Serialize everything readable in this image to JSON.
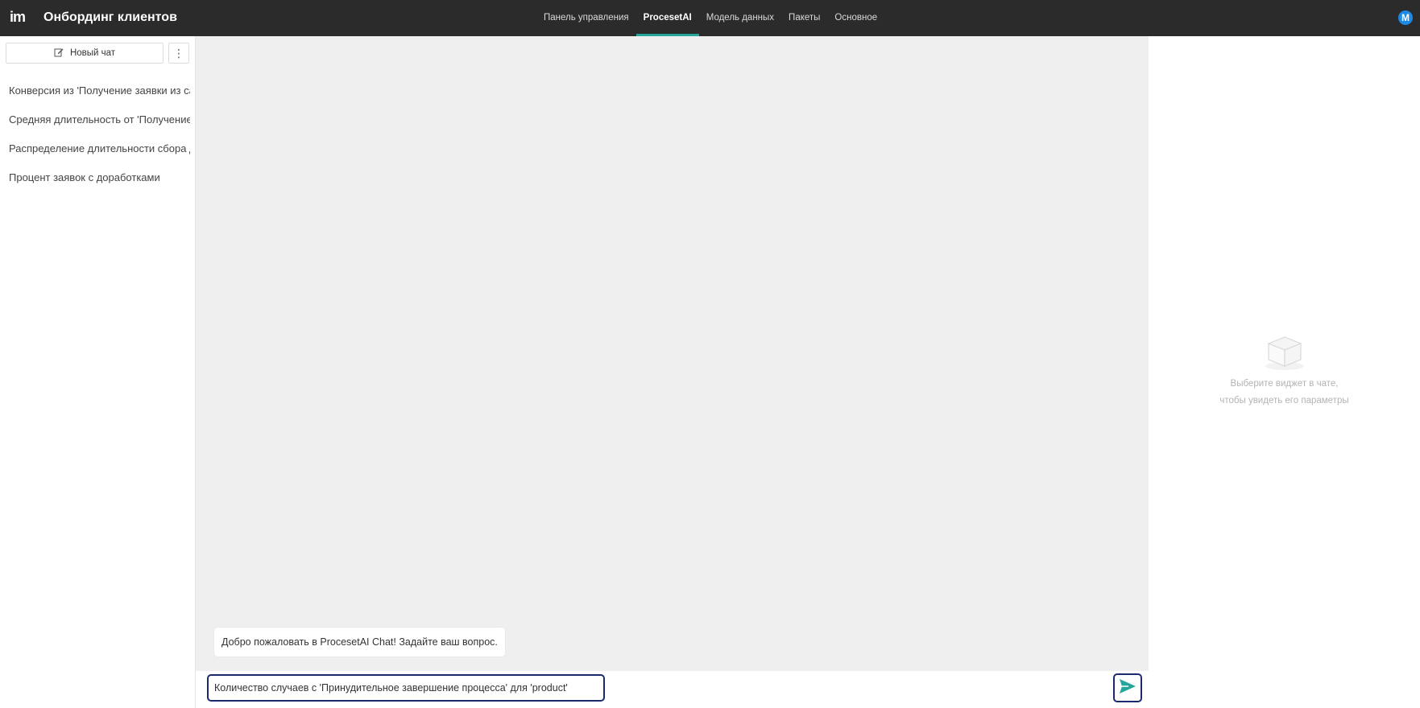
{
  "header": {
    "logo": "im",
    "title": "Онбординг клиентов",
    "tabs": [
      {
        "label": "Панель управления",
        "active": false
      },
      {
        "label": "ProcesetAI",
        "active": true
      },
      {
        "label": "Модель данных",
        "active": false
      },
      {
        "label": "Пакеты",
        "active": false
      },
      {
        "label": "Основное",
        "active": false
      }
    ],
    "avatar_initial": "M",
    "accent_color": "#26a69a"
  },
  "sidebar": {
    "new_chat_label": "Новый чат",
    "more_icon": "⋮",
    "chats": [
      "Конверсия из 'Получение заявки из сайта'",
      "Средняя длительность от 'Получение заявки'",
      "Распределение длительности сбора документов",
      "Процент заявок с доработками"
    ]
  },
  "chat": {
    "welcome_message": "Добро пожаловать в ProcesetAI Chat! Задайте ваш вопрос.",
    "input_value": "Количество случаев с 'Принудительное завершение процесса' для 'product'",
    "send_icon": "send-icon"
  },
  "right_panel": {
    "empty_line1": "Выберите виджет в чате,",
    "empty_line2": "чтобы увидеть его параметры"
  }
}
